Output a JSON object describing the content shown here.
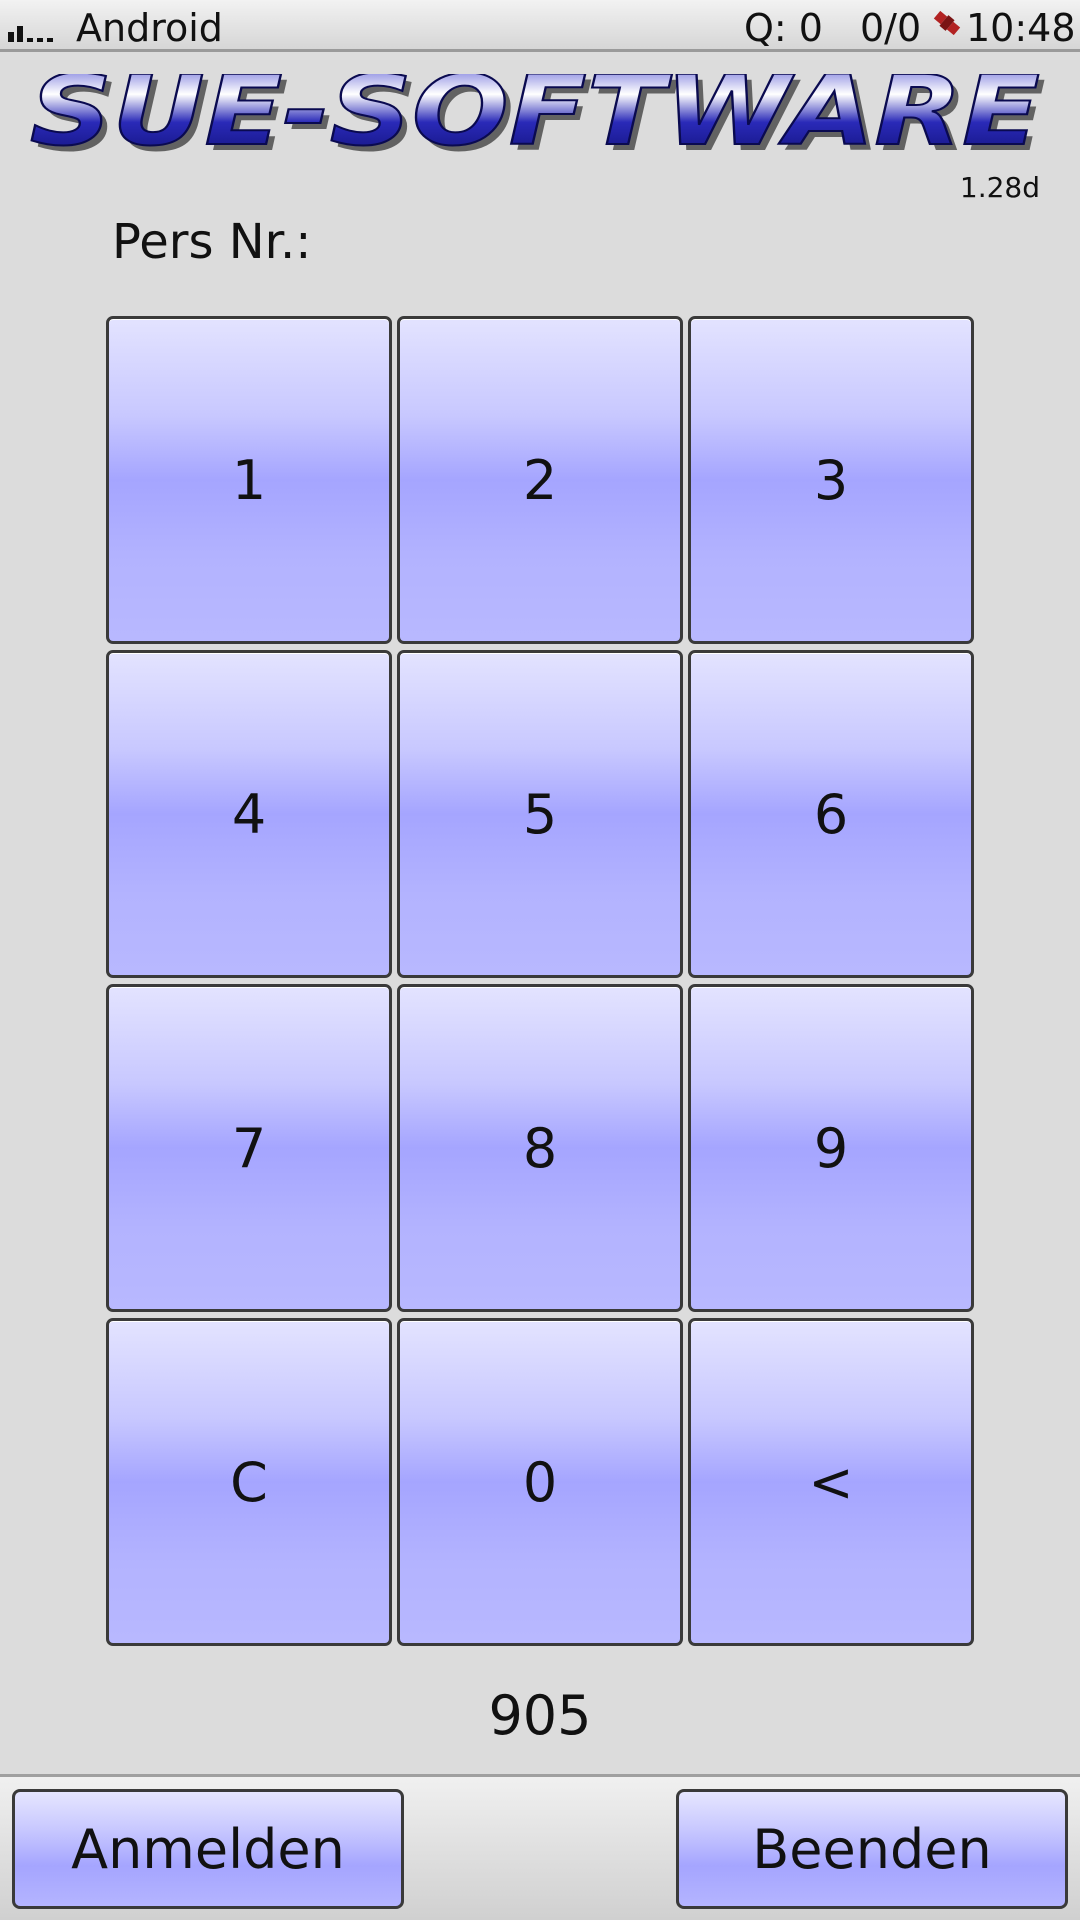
{
  "status_bar": {
    "carrier": "Android",
    "queue": "Q: 0",
    "ratio": "0/0",
    "time": "10:48",
    "signal_icon": "signal-bars-icon",
    "gps_icon": "satellite-icon"
  },
  "header": {
    "logo_text": "SUE-SOFTWARE",
    "version": "1.28d"
  },
  "form": {
    "label": "Pers Nr.:",
    "entry_value": "905"
  },
  "keypad": {
    "keys": [
      "1",
      "2",
      "3",
      "4",
      "5",
      "6",
      "7",
      "8",
      "9",
      "C",
      "0",
      "<"
    ]
  },
  "actions": {
    "login_label": "Anmelden",
    "exit_label": "Beenden"
  },
  "colors": {
    "background": "#dcdcdc",
    "key_gradient_mid": "#a5a5ff",
    "logo_blue": "#1a1a9a"
  }
}
